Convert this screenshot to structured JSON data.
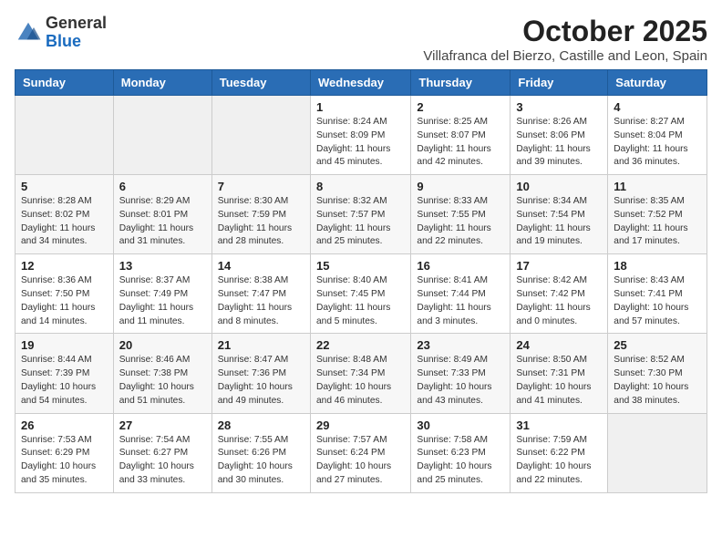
{
  "header": {
    "logo_general": "General",
    "logo_blue": "Blue",
    "main_title": "October 2025",
    "subtitle": "Villafranca del Bierzo, Castille and Leon, Spain"
  },
  "weekdays": [
    "Sunday",
    "Monday",
    "Tuesday",
    "Wednesday",
    "Thursday",
    "Friday",
    "Saturday"
  ],
  "weeks": [
    [
      {
        "day": "",
        "info": ""
      },
      {
        "day": "",
        "info": ""
      },
      {
        "day": "",
        "info": ""
      },
      {
        "day": "1",
        "info": "Sunrise: 8:24 AM\nSunset: 8:09 PM\nDaylight: 11 hours and 45 minutes."
      },
      {
        "day": "2",
        "info": "Sunrise: 8:25 AM\nSunset: 8:07 PM\nDaylight: 11 hours and 42 minutes."
      },
      {
        "day": "3",
        "info": "Sunrise: 8:26 AM\nSunset: 8:06 PM\nDaylight: 11 hours and 39 minutes."
      },
      {
        "day": "4",
        "info": "Sunrise: 8:27 AM\nSunset: 8:04 PM\nDaylight: 11 hours and 36 minutes."
      }
    ],
    [
      {
        "day": "5",
        "info": "Sunrise: 8:28 AM\nSunset: 8:02 PM\nDaylight: 11 hours and 34 minutes."
      },
      {
        "day": "6",
        "info": "Sunrise: 8:29 AM\nSunset: 8:01 PM\nDaylight: 11 hours and 31 minutes."
      },
      {
        "day": "7",
        "info": "Sunrise: 8:30 AM\nSunset: 7:59 PM\nDaylight: 11 hours and 28 minutes."
      },
      {
        "day": "8",
        "info": "Sunrise: 8:32 AM\nSunset: 7:57 PM\nDaylight: 11 hours and 25 minutes."
      },
      {
        "day": "9",
        "info": "Sunrise: 8:33 AM\nSunset: 7:55 PM\nDaylight: 11 hours and 22 minutes."
      },
      {
        "day": "10",
        "info": "Sunrise: 8:34 AM\nSunset: 7:54 PM\nDaylight: 11 hours and 19 minutes."
      },
      {
        "day": "11",
        "info": "Sunrise: 8:35 AM\nSunset: 7:52 PM\nDaylight: 11 hours and 17 minutes."
      }
    ],
    [
      {
        "day": "12",
        "info": "Sunrise: 8:36 AM\nSunset: 7:50 PM\nDaylight: 11 hours and 14 minutes."
      },
      {
        "day": "13",
        "info": "Sunrise: 8:37 AM\nSunset: 7:49 PM\nDaylight: 11 hours and 11 minutes."
      },
      {
        "day": "14",
        "info": "Sunrise: 8:38 AM\nSunset: 7:47 PM\nDaylight: 11 hours and 8 minutes."
      },
      {
        "day": "15",
        "info": "Sunrise: 8:40 AM\nSunset: 7:45 PM\nDaylight: 11 hours and 5 minutes."
      },
      {
        "day": "16",
        "info": "Sunrise: 8:41 AM\nSunset: 7:44 PM\nDaylight: 11 hours and 3 minutes."
      },
      {
        "day": "17",
        "info": "Sunrise: 8:42 AM\nSunset: 7:42 PM\nDaylight: 11 hours and 0 minutes."
      },
      {
        "day": "18",
        "info": "Sunrise: 8:43 AM\nSunset: 7:41 PM\nDaylight: 10 hours and 57 minutes."
      }
    ],
    [
      {
        "day": "19",
        "info": "Sunrise: 8:44 AM\nSunset: 7:39 PM\nDaylight: 10 hours and 54 minutes."
      },
      {
        "day": "20",
        "info": "Sunrise: 8:46 AM\nSunset: 7:38 PM\nDaylight: 10 hours and 51 minutes."
      },
      {
        "day": "21",
        "info": "Sunrise: 8:47 AM\nSunset: 7:36 PM\nDaylight: 10 hours and 49 minutes."
      },
      {
        "day": "22",
        "info": "Sunrise: 8:48 AM\nSunset: 7:34 PM\nDaylight: 10 hours and 46 minutes."
      },
      {
        "day": "23",
        "info": "Sunrise: 8:49 AM\nSunset: 7:33 PM\nDaylight: 10 hours and 43 minutes."
      },
      {
        "day": "24",
        "info": "Sunrise: 8:50 AM\nSunset: 7:31 PM\nDaylight: 10 hours and 41 minutes."
      },
      {
        "day": "25",
        "info": "Sunrise: 8:52 AM\nSunset: 7:30 PM\nDaylight: 10 hours and 38 minutes."
      }
    ],
    [
      {
        "day": "26",
        "info": "Sunrise: 7:53 AM\nSunset: 6:29 PM\nDaylight: 10 hours and 35 minutes."
      },
      {
        "day": "27",
        "info": "Sunrise: 7:54 AM\nSunset: 6:27 PM\nDaylight: 10 hours and 33 minutes."
      },
      {
        "day": "28",
        "info": "Sunrise: 7:55 AM\nSunset: 6:26 PM\nDaylight: 10 hours and 30 minutes."
      },
      {
        "day": "29",
        "info": "Sunrise: 7:57 AM\nSunset: 6:24 PM\nDaylight: 10 hours and 27 minutes."
      },
      {
        "day": "30",
        "info": "Sunrise: 7:58 AM\nSunset: 6:23 PM\nDaylight: 10 hours and 25 minutes."
      },
      {
        "day": "31",
        "info": "Sunrise: 7:59 AM\nSunset: 6:22 PM\nDaylight: 10 hours and 22 minutes."
      },
      {
        "day": "",
        "info": ""
      }
    ]
  ]
}
